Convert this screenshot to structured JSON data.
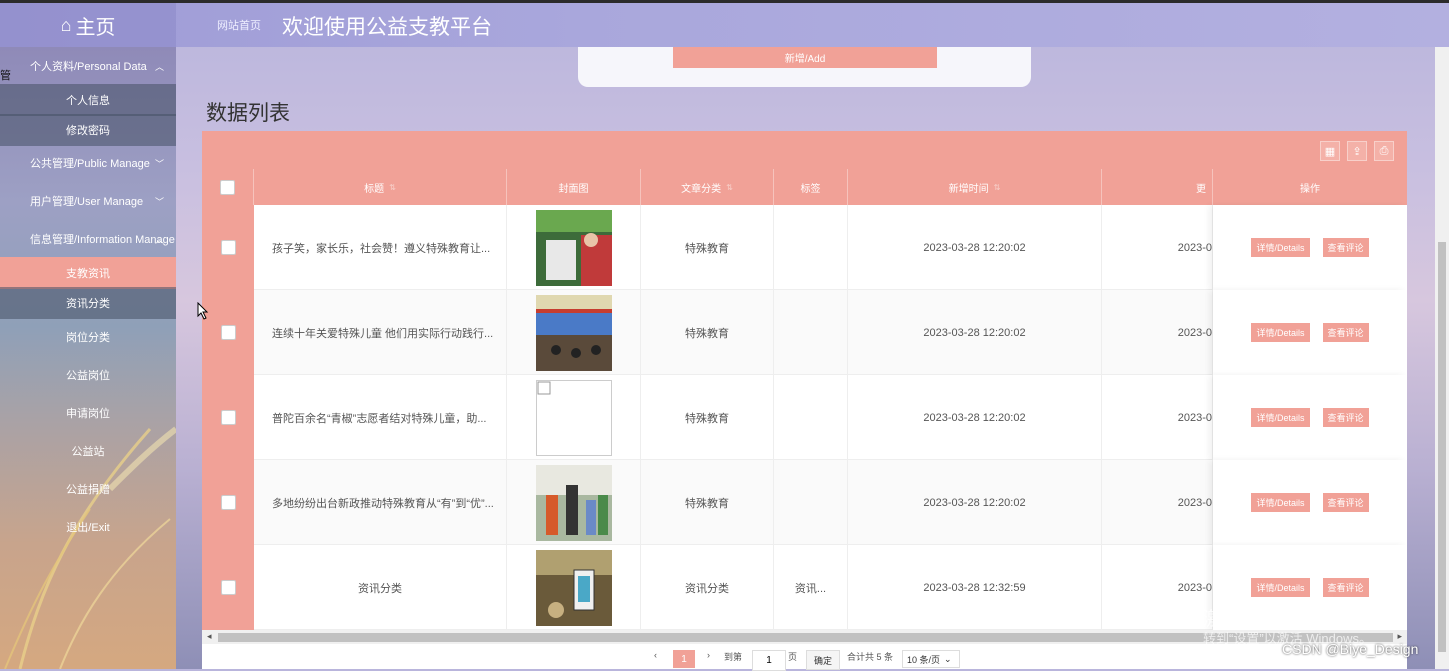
{
  "header": {
    "home_label": "主页",
    "breadcrumb": "网站首页",
    "title": "欢迎使用公益支教平台"
  },
  "sidebar": {
    "stub": "管",
    "items": [
      {
        "label": "个人资料/Personal Data",
        "type": "group",
        "chev": "^"
      },
      {
        "label": "个人信息",
        "type": "sub"
      },
      {
        "label": "修改密码",
        "type": "sub"
      },
      {
        "label": "公共管理/Public Manage",
        "type": "group",
        "chev": "v"
      },
      {
        "label": "用户管理/User Manage",
        "type": "group",
        "chev": "v"
      },
      {
        "label": "信息管理/Information Manage",
        "type": "group",
        "chev": "^"
      },
      {
        "label": "支教资讯",
        "type": "sub",
        "active": true
      },
      {
        "label": "资讯分类",
        "type": "sub"
      },
      {
        "label": "岗位分类",
        "type": "sub"
      },
      {
        "label": "公益岗位",
        "type": "sub"
      },
      {
        "label": "申请岗位",
        "type": "sub"
      },
      {
        "label": "公益站",
        "type": "sub"
      },
      {
        "label": "公益捐赠",
        "type": "sub"
      },
      {
        "label": "退出/Exit",
        "type": "sub"
      }
    ]
  },
  "main": {
    "add_button": "新增/Add",
    "list_title": "数据列表",
    "columns": [
      "标题",
      "封面图",
      "文章分类",
      "标签",
      "新增时间",
      "更",
      "操作"
    ],
    "rows": [
      {
        "title": "孩子笑，家长乐，社会赞！遵义特殊教育让...",
        "category": "特殊教育",
        "tag": "",
        "time": "2023-03-28 12:20:02",
        "time2": "2023-0",
        "cover": "photo-green"
      },
      {
        "title": "连续十年关爱特殊儿童 他们用实际行动践行...",
        "category": "特殊教育",
        "tag": "",
        "time": "2023-03-28 12:20:02",
        "time2": "2023-0",
        "cover": "photo-stage"
      },
      {
        "title": "普陀百余名“青椒”志愿者结对特殊儿童，助...",
        "category": "特殊教育",
        "tag": "",
        "time": "2023-03-28 12:20:02",
        "time2": "2023-0",
        "cover": "broken"
      },
      {
        "title": "多地纷纷出台新政推动特殊教育从“有”到“优”...",
        "category": "特殊教育",
        "tag": "",
        "time": "2023-03-28 12:20:02",
        "time2": "2023-0",
        "cover": "photo-class"
      },
      {
        "title": "资讯分类",
        "category": "资讯分类",
        "tag": "资讯...",
        "time": "2023-03-28 12:32:59",
        "time2": "2023-0",
        "cover": "photo-phone"
      }
    ],
    "op_details": "详情/Details",
    "op_comments": "查看评论"
  },
  "pager": {
    "current": "1",
    "goto": "到第",
    "page_value": "1",
    "page_unit": "页",
    "confirm": "确定",
    "total": "合计共 5 条",
    "page_size": "10 条/页"
  },
  "overlay": {
    "watermark1": "激活 Windows",
    "watermark2": "转到“设置”以激活 Windows。",
    "csdn": "CSDN @Biye_Design"
  },
  "colors": {
    "accent": "#f1a197",
    "header": "#a9a7dc"
  }
}
